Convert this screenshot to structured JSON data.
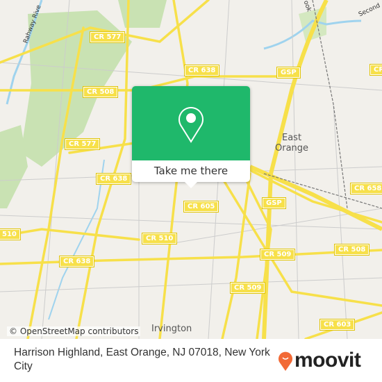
{
  "map": {
    "attribution": "© OpenStreetMap contributors",
    "places": [
      "East\nOrange",
      "Irvington"
    ],
    "east_orange_line1": "East",
    "east_orange_line2": "Orange",
    "irvington": "Irvington",
    "rotated_labels": {
      "rahway": "Rahway Rive",
      "second": "Second A",
      "brook": "ook"
    },
    "shields": [
      "CR 577",
      "CR 638",
      "CR 508",
      "CR 577",
      "CR 638",
      "CR 605",
      "GSP",
      "GSP",
      "CR 510",
      "CR 509",
      "CR 508",
      "CR 638",
      "CR 509",
      "CR 603",
      "CR 658",
      "510",
      "CR"
    ],
    "colors": {
      "background": "#f2f0eb",
      "park": "#c9e2b3",
      "road": "#f7e04a",
      "water": "#9fd3ee",
      "popup": "#1fb86b"
    }
  },
  "popup": {
    "button_label": "Take me there",
    "icon": "map-pin-icon"
  },
  "footer": {
    "address": "Harrison Highland, East Orange, NJ 07018, New York City",
    "brand": "moovit",
    "brand_color": "#f26a36"
  }
}
